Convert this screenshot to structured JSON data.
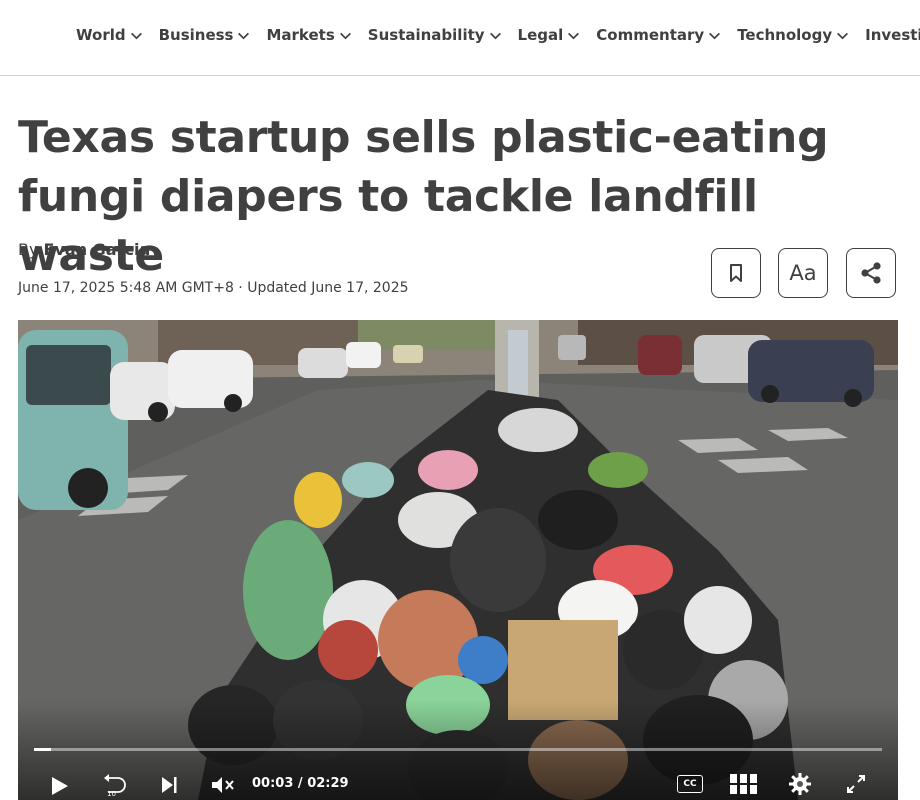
{
  "nav": {
    "items": [
      {
        "label": "World"
      },
      {
        "label": "Business"
      },
      {
        "label": "Markets"
      },
      {
        "label": "Sustainability"
      },
      {
        "label": "Legal"
      },
      {
        "label": "Commentary"
      },
      {
        "label": "Technology"
      },
      {
        "label": "Investigations"
      }
    ]
  },
  "article": {
    "headline": "Texas startup sells plastic-eating fungi diapers to tackle landfill waste",
    "by_prefix": "By",
    "author": "Evan Garcia",
    "dateline": "June 17, 2025 5:48 AM GMT+8 · Updated June 17, 2025"
  },
  "actions": {
    "bookmark_icon": "bookmark-icon",
    "text_size_label": "Aa",
    "share_icon": "share-icon"
  },
  "video": {
    "progress_fraction": 0.02,
    "current_time": "00:03",
    "separator": "/",
    "duration": "02:29",
    "cc_label": "CC",
    "icons": [
      "play-icon",
      "rewind-10-icon",
      "skip-next-icon",
      "mute-icon",
      "closed-captions-icon",
      "grid-icon",
      "gear-icon",
      "fullscreen-icon"
    ]
  },
  "colors": {
    "text": "#404040",
    "border": "#d6d6d6",
    "video_bg": "#6a6a68"
  }
}
